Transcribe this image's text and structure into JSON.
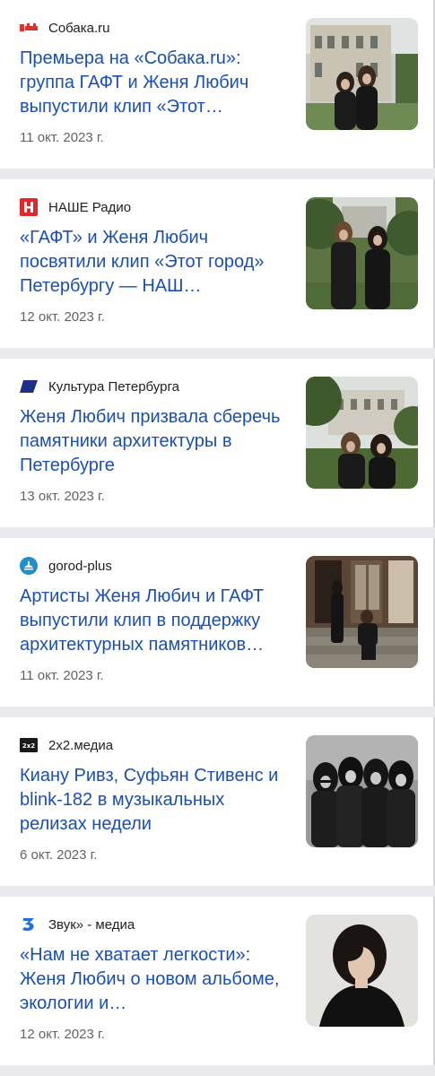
{
  "articles": [
    {
      "source": "Собака.ru",
      "source_icon": "sobaka-logo-icon",
      "headline": "Премьера на «Собака.ru»: группа ГАФТ и Женя Любич выпустили клип «Этот…",
      "date": "11 окт. 2023 г.",
      "thumbnail": "mansion-couple-photo"
    },
    {
      "source": "НАШЕ Радио",
      "source_icon": "nashe-radio-logo-icon",
      "headline": "«ГАФТ» и Женя Любич посвятили клип «Этот город» Петербургу — НАШ…",
      "date": "12 окт. 2023 г.",
      "thumbnail": "park-couple-photo"
    },
    {
      "source": "Культура Петербурга",
      "source_icon": "kultura-logo-icon",
      "headline": "Женя Любич призвала сберечь памятники архитектуры в Петербурге",
      "date": "13 окт. 2023 г.",
      "thumbnail": "garden-couple-photo"
    },
    {
      "source": "gorod-plus",
      "source_icon": "gorod-plus-logo-icon",
      "headline": "Артисты Женя Любич и ГАФТ выпустили клип в поддержку архитектурных памятников…",
      "date": "11 окт. 2023 г.",
      "thumbnail": "steps-couple-photo"
    },
    {
      "source": "2x2.медиа",
      "source_icon": "2x2-logo-icon",
      "headline": "Киану Ривз, Суфьян Стивенс и blink-182 в музыкальных релизах недели",
      "date": "6 окт. 2023 г.",
      "thumbnail": "band-bw-photo"
    },
    {
      "source": "Звук» - медиа",
      "source_icon": "zvuk-logo-icon",
      "headline": "«Нам не хватает легкости»: Женя Любич о новом альбоме, экологии и…",
      "date": "12 окт. 2023 г.",
      "thumbnail": "portrait-woman-photo"
    }
  ],
  "colors": {
    "headline": "#1a4fb0",
    "source_text": "#202124",
    "date_text": "#5f6368",
    "card_bg": "#ffffff",
    "divider": "#e9e9ee"
  }
}
